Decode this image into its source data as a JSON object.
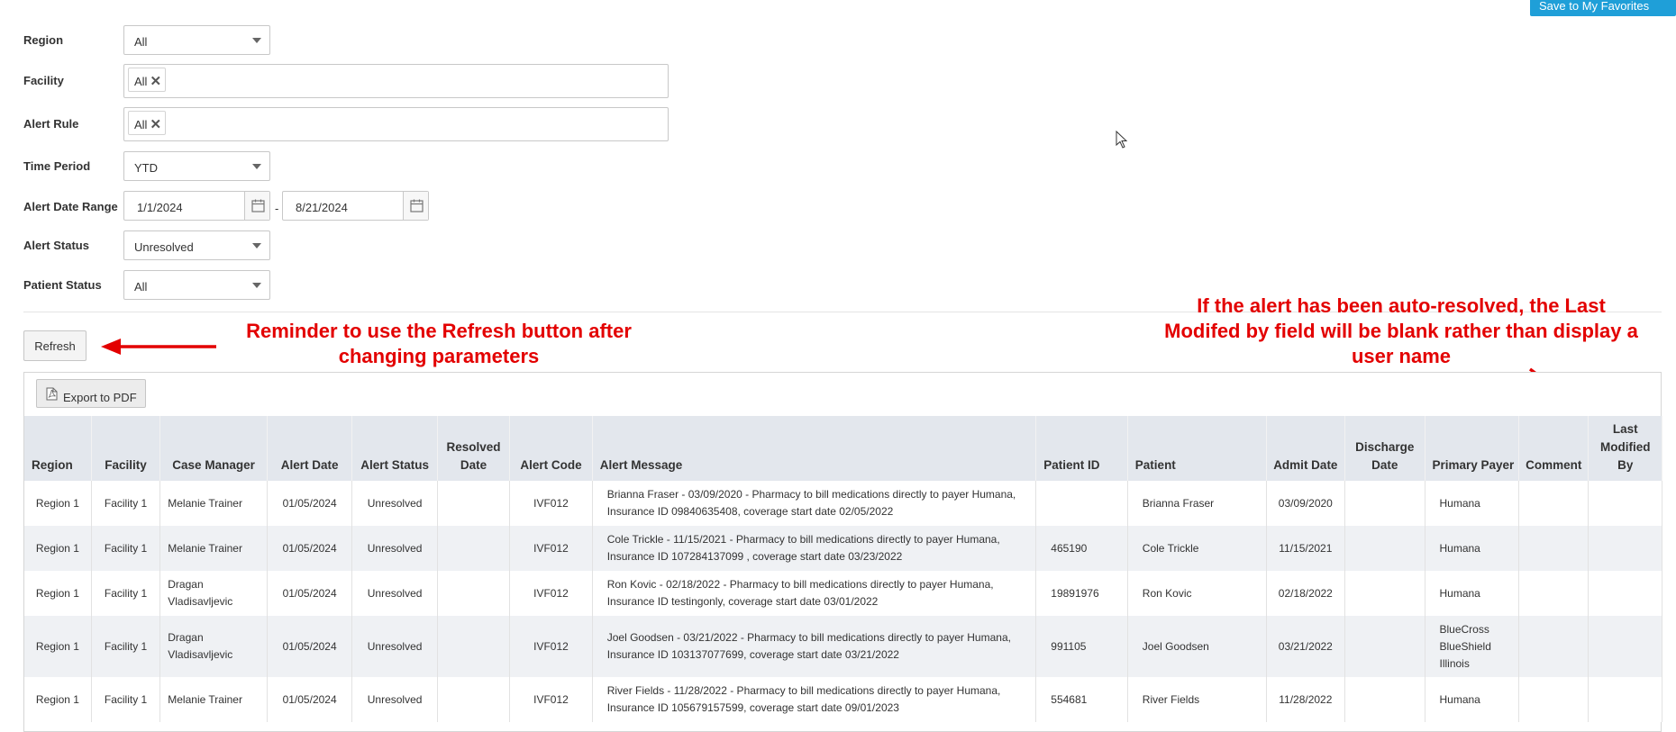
{
  "toolbar": {
    "save_favorites_label": "Save to My Favorites"
  },
  "filters": {
    "region": {
      "label": "Region",
      "value": "All"
    },
    "facility": {
      "label": "Facility",
      "tag": "All"
    },
    "alert_rule": {
      "label": "Alert Rule",
      "tag": "All"
    },
    "time_period": {
      "label": "Time Period",
      "value": "YTD"
    },
    "alert_date_range": {
      "label": "Alert Date Range",
      "start": "1/1/2024",
      "separator": "-",
      "end": "8/21/2024"
    },
    "alert_status": {
      "label": "Alert Status",
      "value": "Unresolved"
    },
    "patient_status": {
      "label": "Patient Status",
      "value": "All"
    }
  },
  "refresh_label": "Refresh",
  "export_label": "Export to PDF",
  "annotations": {
    "refresh_note": "Reminder to use the Refresh button after changing parameters",
    "last_modified_note": "If the alert has been auto-resolved, the Last Modifed by field will be blank rather than display a user name"
  },
  "colors": {
    "annotation": "#e30000",
    "save_button": "#1f9fd8",
    "header_bg": "#e3e7ed",
    "alt_row": "#eff1f4"
  },
  "table": {
    "columns": [
      "Region",
      "Facility",
      "Case Manager",
      "Alert Date",
      "Alert Status",
      "Resolved Date",
      "Alert Code",
      "Alert Message",
      "Patient ID",
      "Patient",
      "Admit Date",
      "Discharge Date",
      "Primary Payer",
      "Comment",
      "Last Modified By"
    ],
    "rows": [
      {
        "region": "Region 1",
        "facility": "Facility 1",
        "case_manager": "Melanie Trainer",
        "alert_date": "01/05/2024",
        "alert_status": "Unresolved",
        "resolved_date": "",
        "alert_code": "IVF012",
        "alert_message": "Brianna Fraser - 03/09/2020 - Pharmacy to bill medications directly to payer Humana, Insurance ID 09840635408, coverage start date 02/05/2022",
        "patient_id": "",
        "patient": "Brianna Fraser",
        "admit_date": "03/09/2020",
        "discharge_date": "",
        "primary_payer": "Humana",
        "comment": "",
        "last_modified_by": ""
      },
      {
        "region": "Region 1",
        "facility": "Facility 1",
        "case_manager": "Melanie Trainer",
        "alert_date": "01/05/2024",
        "alert_status": "Unresolved",
        "resolved_date": "",
        "alert_code": "IVF012",
        "alert_message": "Cole Trickle - 11/15/2021 - Pharmacy to bill medications directly to payer Humana, Insurance ID 107284137099 , coverage start date 03/23/2022",
        "patient_id": "465190",
        "patient": "Cole Trickle",
        "admit_date": "11/15/2021",
        "discharge_date": "",
        "primary_payer": "Humana",
        "comment": "",
        "last_modified_by": ""
      },
      {
        "region": "Region 1",
        "facility": "Facility 1",
        "case_manager": "Dragan Vladisavljevic",
        "alert_date": "01/05/2024",
        "alert_status": "Unresolved",
        "resolved_date": "",
        "alert_code": "IVF012",
        "alert_message": "Ron Kovic - 02/18/2022 - Pharmacy to bill medications directly to payer Humana, Insurance ID testingonly, coverage start date 03/01/2022",
        "patient_id": "19891976",
        "patient": "Ron Kovic",
        "admit_date": "02/18/2022",
        "discharge_date": "",
        "primary_payer": "Humana",
        "comment": "",
        "last_modified_by": ""
      },
      {
        "region": "Region 1",
        "facility": "Facility 1",
        "case_manager": "Dragan Vladisavljevic",
        "alert_date": "01/05/2024",
        "alert_status": "Unresolved",
        "resolved_date": "",
        "alert_code": "IVF012",
        "alert_message": "Joel Goodsen - 03/21/2022 - Pharmacy to bill medications directly to payer Humana, Insurance ID 103137077699, coverage start date 03/21/2022",
        "patient_id": "991105",
        "patient": "Joel Goodsen",
        "admit_date": "03/21/2022",
        "discharge_date": "",
        "primary_payer": "BlueCross BlueShield Illinois",
        "comment": "",
        "last_modified_by": ""
      },
      {
        "region": "Region 1",
        "facility": "Facility 1",
        "case_manager": "Melanie Trainer",
        "alert_date": "01/05/2024",
        "alert_status": "Unresolved",
        "resolved_date": "",
        "alert_code": "IVF012",
        "alert_message": "River Fields - 11/28/2022 - Pharmacy to bill medications directly to payer Humana, Insurance ID 105679157599, coverage start date 09/01/2023",
        "patient_id": "554681",
        "patient": "River Fields",
        "admit_date": "11/28/2022",
        "discharge_date": "",
        "primary_payer": "Humana",
        "comment": "",
        "last_modified_by": ""
      }
    ]
  }
}
